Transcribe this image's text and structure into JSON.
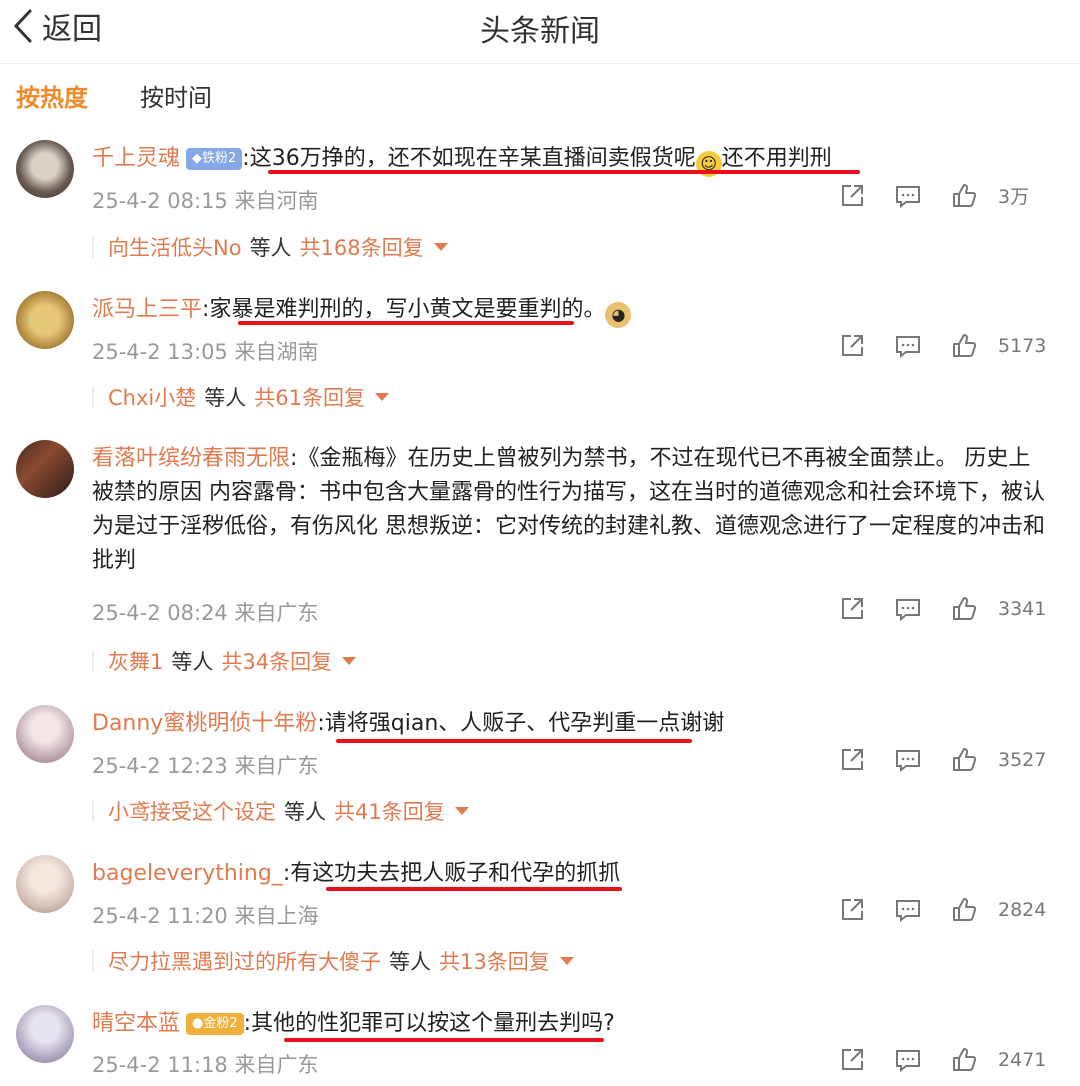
{
  "header": {
    "back_label": "返回",
    "title": "头条新闻"
  },
  "sort": {
    "hot": "按热度",
    "time": "按时间"
  },
  "comments": [
    {
      "name": "千上灵魂",
      "badge": "铁粉2",
      "badge_color": "#86a8e6",
      "sep": ":",
      "text": "这36万挣的，还不如现在辛某直播间卖假货呢",
      "text_after": "还不用判刑",
      "meta": "25-4-2 08:15 来自河南",
      "likes": "3万",
      "reply_name": "向生活低头No",
      "reply_mid": "等人",
      "reply_count": "共168条回复"
    },
    {
      "name": "派马上三平",
      "sep": ":",
      "text": "家暴是难判刑的，写小黄文是要重判的。",
      "meta": "25-4-2 13:05 来自湖南",
      "likes": "5173",
      "reply_name": "Chxi小楚",
      "reply_mid": "等人",
      "reply_count": "共61条回复"
    },
    {
      "name": "看落叶缤纷春雨无限",
      "sep": ":",
      "text": "《金瓶梅》在历史上曾被列为禁书，不过在现代已不再被全面禁止。 历史上被禁的原因 内容露骨：书中包含大量露骨的性行为描写，这在当时的道德观念和社会环境下，被认为是过于淫秽低俗，有伤风化 思想叛逆：它对传统的封建礼教、道德观念进行了一定程度的冲击和批判",
      "meta": "25-4-2 08:24 来自广东",
      "likes": "3341",
      "reply_name": "灰舞1",
      "reply_mid": "等人",
      "reply_count": "共34条回复"
    },
    {
      "name": "Danny蜜桃明侦十年粉",
      "sep": ":",
      "text": "请将强qian、人贩子、代孕判重一点谢谢",
      "meta": "25-4-2 12:23 来自广东",
      "likes": "3527",
      "reply_name": "小鸢接受这个设定",
      "reply_mid": "等人",
      "reply_count": "共41条回复"
    },
    {
      "name": "bageleverything_",
      "sep": ":",
      "text": "有这功夫去把人贩子和代孕的抓抓",
      "meta": "25-4-2 11:20 来自上海",
      "likes": "2824",
      "reply_name": "尽力拉黑遇到过的所有大傻子",
      "reply_mid": "等人",
      "reply_count": "共13条回复"
    },
    {
      "name": "晴空本蓝",
      "badge": "金粉2",
      "badge_color": "#f0b03c",
      "sep": ":",
      "text": "其他的性犯罪可以按这个量刑去判吗?",
      "meta": "25-4-2 11:18 来自广东",
      "likes": "2471"
    }
  ],
  "colors": {
    "accent": "#f08a2b",
    "username": "#e07b4f",
    "underline": "#e8101a"
  }
}
